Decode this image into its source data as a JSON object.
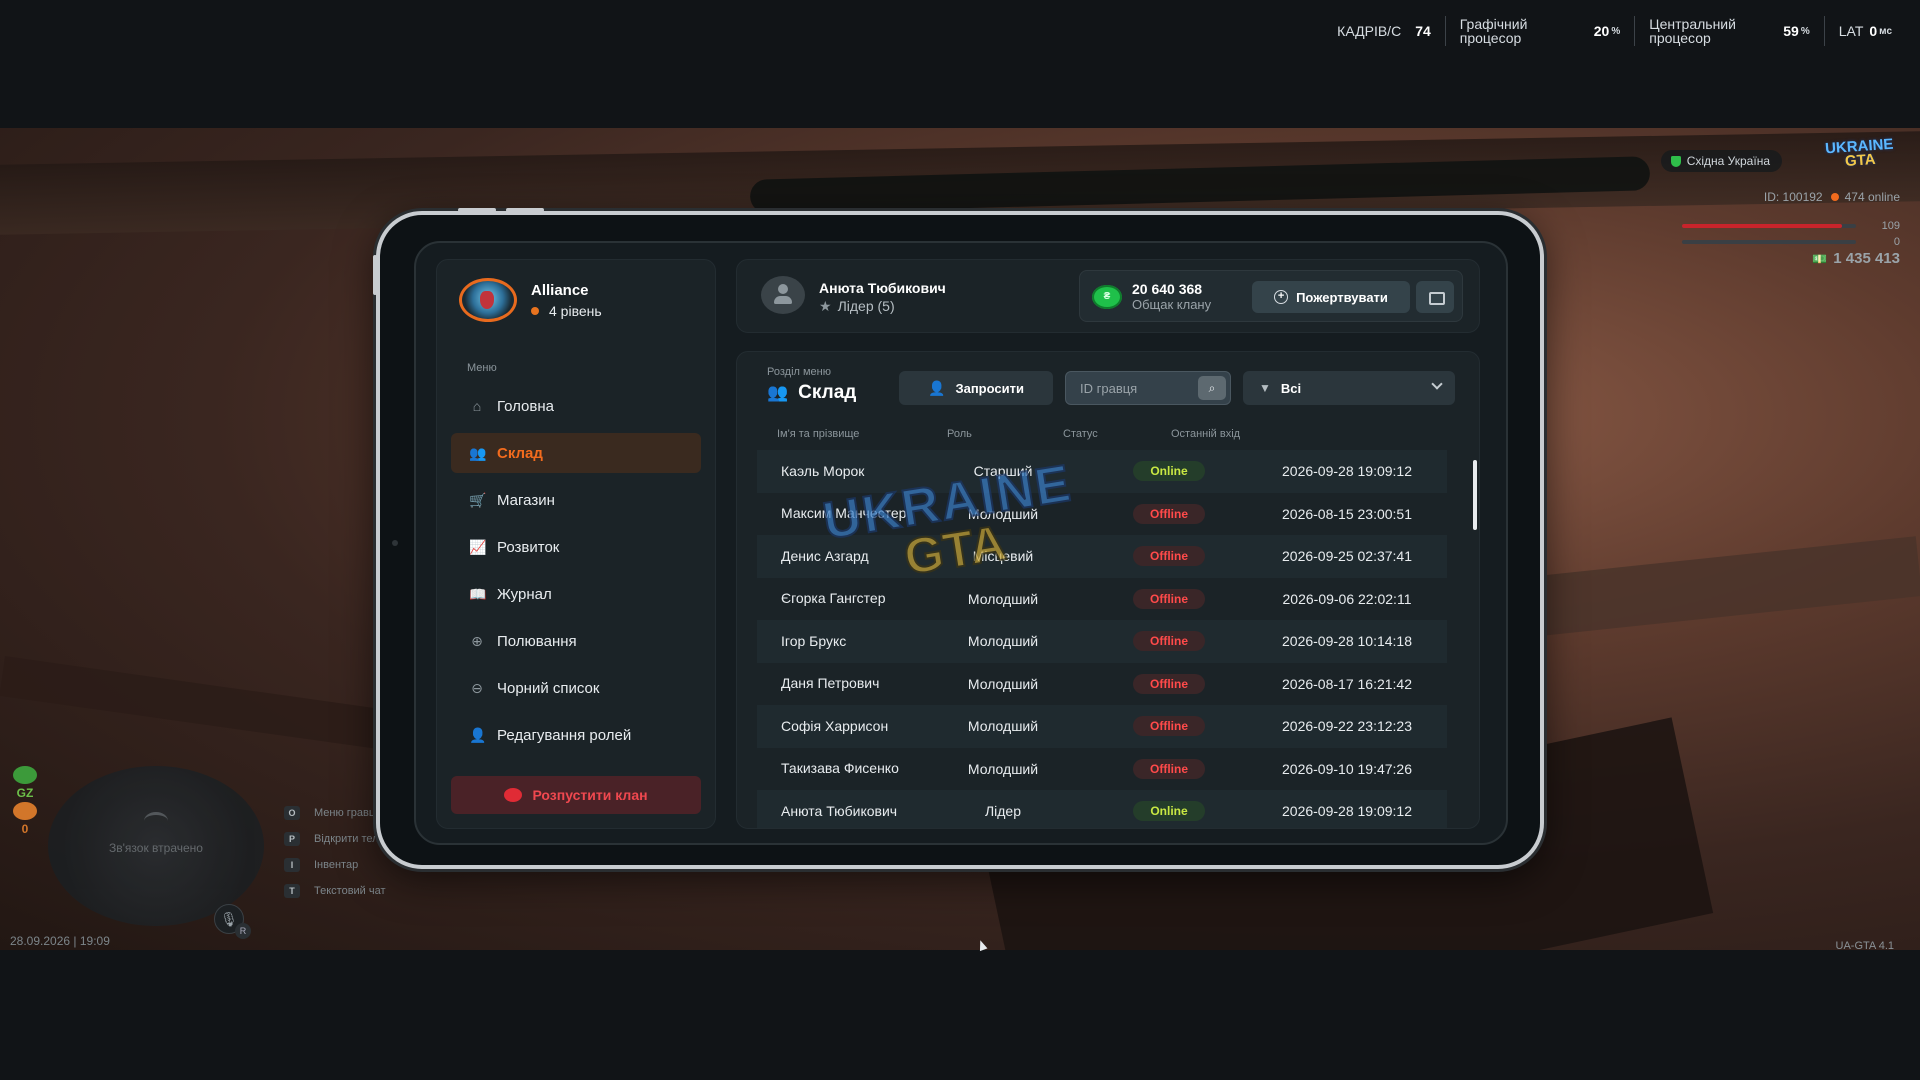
{
  "perf": {
    "fps_label": "КАДРІВ/С",
    "fps_value": "74",
    "gpu_label": "Графічний процесор",
    "gpu_value": "20",
    "gpu_unit": "%",
    "cpu_label": "Центральний процесор",
    "cpu_value": "59",
    "cpu_unit": "%",
    "lat_label": "LAT",
    "lat_value": "0",
    "lat_unit": "мс"
  },
  "hud_right": {
    "region": "Східна Україна",
    "logo_top": "UKRAINE",
    "logo_bottom": "GTA",
    "player_id": "ID: 100192",
    "online": "474 online",
    "health_value": "109",
    "health_fill": 0.92,
    "armor_value": "0",
    "armor_fill": 0,
    "money": "1 435 413"
  },
  "hud_left": {
    "gz_label": "GZ",
    "gz_count": "0",
    "map_status": "Зв'язок втрачено",
    "mic_key": "R",
    "hotkeys": [
      {
        "key": "O",
        "label": "Меню гравця"
      },
      {
        "key": "P",
        "label": "Відкрити телефон"
      },
      {
        "key": "I",
        "label": "Інвентар"
      },
      {
        "key": "T",
        "label": "Текстовий чат"
      }
    ],
    "datetime": "28.09.2026 | 19:09",
    "version": "UA-GTA 4.1"
  },
  "clan": {
    "name": "Alliance",
    "level": "4 рівень"
  },
  "menu": {
    "label": "Меню",
    "items": [
      {
        "label": "Головна",
        "icon": "home-icon",
        "glyph": "⌂"
      },
      {
        "label": "Склад",
        "icon": "users-icon",
        "glyph": "👥",
        "active": true
      },
      {
        "label": "Магазин",
        "icon": "basket-icon",
        "glyph": "🛒"
      },
      {
        "label": "Розвиток",
        "icon": "chart-icon",
        "glyph": "📈"
      },
      {
        "label": "Журнал",
        "icon": "book-icon",
        "glyph": "📖"
      },
      {
        "label": "Полювання",
        "icon": "crosshair-icon",
        "glyph": "⊕"
      },
      {
        "label": "Чорний список",
        "icon": "blocked-icon",
        "glyph": "⊖"
      },
      {
        "label": "Редагування ролей",
        "icon": "user-edit-icon",
        "glyph": "👤"
      }
    ],
    "disband_label": "Розпустити клан"
  },
  "user": {
    "name": "Анюта Тюбикович",
    "role": "Лідер (5)"
  },
  "bank": {
    "amount": "20 640 368",
    "label": "Общак клану",
    "donate_label": "Пожертвувати"
  },
  "section": {
    "label": "Розділ меню",
    "title": "Склад",
    "invite_label": "Запросити",
    "search_placeholder": "ID гравця",
    "filter_value": "Всі"
  },
  "table": {
    "columns": [
      "Ім'я та прізвище",
      "Роль",
      "Статус",
      "Останній вхід"
    ],
    "rows": [
      {
        "name": "Каэль Морок",
        "role": "Старший",
        "status": "Online",
        "last": "2026-09-28 19:09:12"
      },
      {
        "name": "Максим Манчестер",
        "role": "Молодший",
        "status": "Offline",
        "last": "2026-08-15 23:00:51"
      },
      {
        "name": "Денис Азгард",
        "role": "Місцевий",
        "status": "Offline",
        "last": "2026-09-25 02:37:41"
      },
      {
        "name": "Єгорка Гангстер",
        "role": "Молодший",
        "status": "Offline",
        "last": "2026-09-06 22:02:11"
      },
      {
        "name": "Ігор Брукс",
        "role": "Молодший",
        "status": "Offline",
        "last": "2026-09-28 10:14:18"
      },
      {
        "name": "Даня Петрович",
        "role": "Молодший",
        "status": "Offline",
        "last": "2026-08-17 16:21:42"
      },
      {
        "name": "Софія Харрисон",
        "role": "Молодший",
        "status": "Offline",
        "last": "2026-09-22 23:12:23"
      },
      {
        "name": "Такизава Фисенко",
        "role": "Молодший",
        "status": "Offline",
        "last": "2026-09-10 19:47:26"
      },
      {
        "name": "Анюта Тюбикович",
        "role": "Лідер",
        "status": "Online",
        "last": "2026-09-28 19:09:12"
      }
    ]
  },
  "watermark": {
    "top": "UKRAINE",
    "bottom": "GTA"
  },
  "colors": {
    "accent": "#f26b1d",
    "online": "#c8e843",
    "offline": "#ff4a4a",
    "danger": "#e02b35",
    "bank_coin": "#1fc04a"
  }
}
